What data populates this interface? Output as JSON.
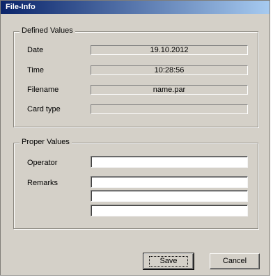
{
  "window": {
    "title": "File-Info"
  },
  "defined": {
    "legend": "Defined Values",
    "rows": [
      {
        "label": "Date",
        "value": "19.10.2012"
      },
      {
        "label": "Time",
        "value": "10:28:56"
      },
      {
        "label": "Filename",
        "value": "name.par"
      },
      {
        "label": "Card type",
        "value": ""
      }
    ]
  },
  "proper": {
    "legend": "Proper Values",
    "operator_label": "Operator",
    "operator_value": "",
    "remarks_label": "Remarks",
    "remarks": [
      "",
      "",
      ""
    ]
  },
  "buttons": {
    "save": "Save",
    "cancel": "Cancel"
  }
}
